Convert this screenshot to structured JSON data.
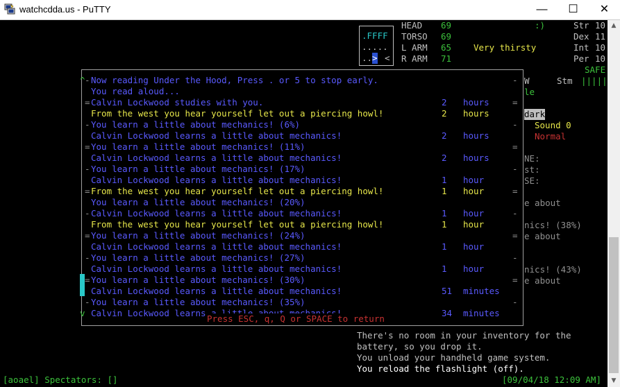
{
  "window": {
    "title": "watchcdda.us - PuTTY",
    "minimize": "—",
    "maximize": "☐",
    "close": "✕"
  },
  "minimap": {
    "row1": ".FFFF",
    "row2": ".....",
    "row3_a": "..",
    "row3_b": ">",
    "row3_c": "<"
  },
  "body_parts": [
    {
      "name": "HEAD",
      "value": "69"
    },
    {
      "name": "TORSO",
      "value": "69"
    },
    {
      "name": "L ARM",
      "value": "65"
    },
    {
      "name": "R ARM",
      "value": "71"
    }
  ],
  "mood": ":)",
  "status_thirst": "Very thirsty",
  "stats": [
    {
      "name": "Str",
      "value": "10"
    },
    {
      "name": "Dex",
      "value": "11"
    },
    {
      "name": "Int",
      "value": "10"
    },
    {
      "name": "Per",
      "value": "10"
    }
  ],
  "safe": "SAFE",
  "side": {
    "w": "W",
    "stm": "Stm",
    "stm_bar": "|||||",
    "le": "le",
    "dark": "dark",
    "sound": "Sound 0",
    "normal": "Normal",
    "ne": "NE:",
    "st": "st:",
    "se": "SE:",
    "about1": "e about",
    "nics38": "nics! (38%)",
    "about2": "e about",
    "nics43": "nics! (43%)",
    "about3": "e about"
  },
  "popup": {
    "footer": "Press ESC, q, Q or SPACE to return",
    "lines": [
      {
        "mark": "^",
        "sep": "-",
        "text": "Now reading Under the Hood, Press . or 5 to stop early.",
        "num": "",
        "unit": "",
        "end": "-",
        "color": "blue"
      },
      {
        "mark": "",
        "sep": " ",
        "text": "You read aloud...",
        "num": "",
        "unit": "",
        "end": "",
        "color": "blue"
      },
      {
        "mark": "",
        "sep": "=",
        "text": "Calvin Lockwood studies with you.",
        "num": "2",
        "unit": "hours",
        "end": "=",
        "color": "blue"
      },
      {
        "mark": "",
        "sep": " ",
        "text": "From the west you hear yourself let out a piercing howl!",
        "num": "2",
        "unit": "hours",
        "end": "",
        "color": "yellow"
      },
      {
        "mark": "",
        "sep": "-",
        "text": "You learn a little about mechanics! (6%)",
        "num": "",
        "unit": "",
        "end": "-",
        "color": "blue"
      },
      {
        "mark": "",
        "sep": " ",
        "text": "Calvin Lockwood learns a little about mechanics!",
        "num": "2",
        "unit": "hours",
        "end": "",
        "color": "blue"
      },
      {
        "mark": "",
        "sep": "=",
        "text": "You learn a little about mechanics! (11%)",
        "num": "",
        "unit": "",
        "end": "=",
        "color": "blue"
      },
      {
        "mark": "",
        "sep": " ",
        "text": "Calvin Lockwood learns a little about mechanics!",
        "num": "2",
        "unit": "hours",
        "end": "",
        "color": "blue"
      },
      {
        "mark": "",
        "sep": "-",
        "text": "You learn a little about mechanics! (17%)",
        "num": "",
        "unit": "",
        "end": "-",
        "color": "blue"
      },
      {
        "mark": "",
        "sep": " ",
        "text": "Calvin Lockwood learns a little about mechanics!",
        "num": "1",
        "unit": "hour",
        "end": "",
        "color": "blue"
      },
      {
        "mark": "",
        "sep": "=",
        "text": "From the west you hear yourself let out a piercing howl!",
        "num": "1",
        "unit": "hour",
        "end": "=",
        "color": "yellow"
      },
      {
        "mark": "",
        "sep": " ",
        "text": "You learn a little about mechanics! (20%)",
        "num": "",
        "unit": "",
        "end": "",
        "color": "blue"
      },
      {
        "mark": "",
        "sep": "-",
        "text": "Calvin Lockwood learns a little about mechanics!",
        "num": "1",
        "unit": "hour",
        "end": "-",
        "color": "blue"
      },
      {
        "mark": "",
        "sep": " ",
        "text": "From the west you hear yourself let out a piercing howl!",
        "num": "1",
        "unit": "hour",
        "end": "",
        "color": "yellow"
      },
      {
        "mark": "",
        "sep": "=",
        "text": "You learn a little about mechanics! (24%)",
        "num": "",
        "unit": "",
        "end": "=",
        "color": "blue"
      },
      {
        "mark": "",
        "sep": " ",
        "text": "Calvin Lockwood learns a little about mechanics!",
        "num": "1",
        "unit": "hour",
        "end": "",
        "color": "blue"
      },
      {
        "mark": "",
        "sep": "-",
        "text": "You learn a little about mechanics! (27%)",
        "num": "",
        "unit": "",
        "end": "-",
        "color": "blue"
      },
      {
        "mark": "",
        "sep": " ",
        "text": "Calvin Lockwood learns a little about mechanics!",
        "num": "1",
        "unit": "hour",
        "end": "",
        "color": "blue"
      },
      {
        "mark": "",
        "sep": "=",
        "text": "You learn a little about mechanics! (30%)",
        "num": "",
        "unit": "",
        "end": "=",
        "color": "blue"
      },
      {
        "mark": "",
        "sep": " ",
        "text": "Calvin Lockwood learns a little about mechanics!",
        "num": "51",
        "unit": "minutes",
        "end": "",
        "color": "blue"
      },
      {
        "mark": "",
        "sep": "-",
        "text": "You learn a little about mechanics! (35%)",
        "num": "",
        "unit": "",
        "end": "-",
        "color": "blue"
      },
      {
        "mark": "v",
        "sep": " ",
        "text": "Calvin Lockwood learns a little about mechanics!",
        "num": "34",
        "unit": "minutes",
        "end": "",
        "color": "blue"
      }
    ]
  },
  "log": [
    "There's no room in your inventory for the",
    "battery, so you drop it.",
    "You unload your handheld game system.",
    "You reload the flashlight (off)."
  ],
  "statusbar": {
    "left": "[aoael] Spectators: []",
    "right": "[09/04/18 12:09 AM]"
  }
}
